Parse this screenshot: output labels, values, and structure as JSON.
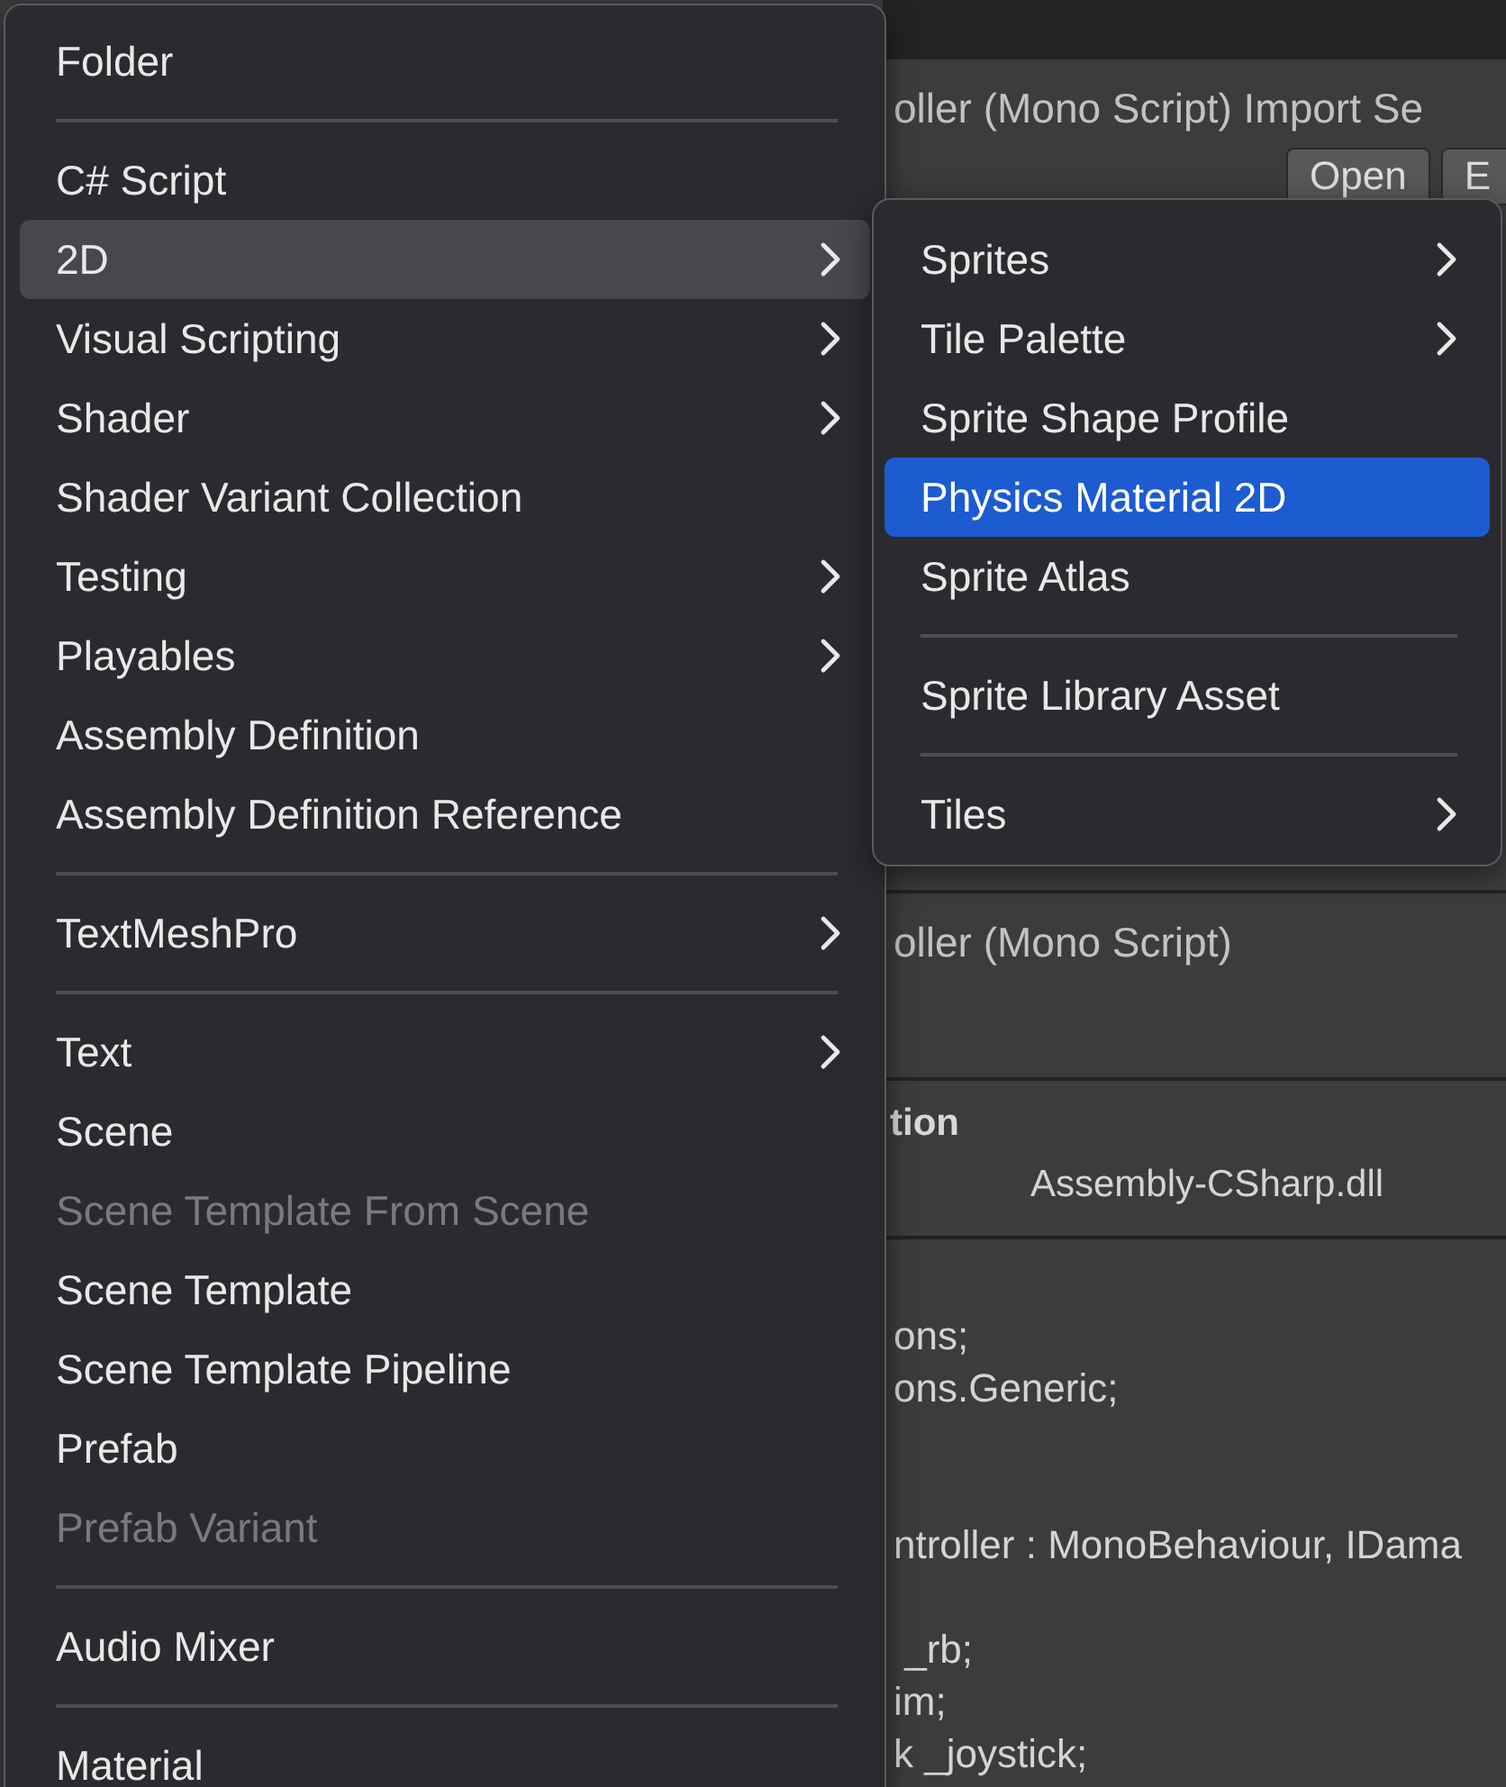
{
  "inspector": {
    "title": "oller (Mono Script) Import Se",
    "buttons": [
      "Open",
      "E"
    ],
    "subtitle": "oller (Mono Script)",
    "section_heading": "tion",
    "assembly": "Assembly-CSharp.dll",
    "code_lines": [
      {
        "kind": "blank"
      },
      {
        "kind": "line",
        "text": "ons;"
      },
      {
        "kind": "line",
        "text": "ons.Generic;"
      },
      {
        "kind": "blank"
      },
      {
        "kind": "blank"
      },
      {
        "kind": "line",
        "text": "ntroller : MonoBehaviour, IDama"
      },
      {
        "kind": "blank"
      },
      {
        "kind": "line",
        "text": " _rb;"
      },
      {
        "kind": "line",
        "text": "im;"
      },
      {
        "kind": "line",
        "text": "k _joystick;"
      }
    ]
  },
  "menu": {
    "items": [
      {
        "kind": "item",
        "label": "Folder",
        "submenu": false,
        "disabled": false,
        "selected": false
      },
      {
        "kind": "separator"
      },
      {
        "kind": "item",
        "label": "C# Script",
        "submenu": false,
        "disabled": false,
        "selected": false
      },
      {
        "kind": "item",
        "label": "2D",
        "submenu": true,
        "disabled": false,
        "selected": true
      },
      {
        "kind": "item",
        "label": "Visual Scripting",
        "submenu": true,
        "disabled": false,
        "selected": false
      },
      {
        "kind": "item",
        "label": "Shader",
        "submenu": true,
        "disabled": false,
        "selected": false
      },
      {
        "kind": "item",
        "label": "Shader Variant Collection",
        "submenu": false,
        "disabled": false,
        "selected": false
      },
      {
        "kind": "item",
        "label": "Testing",
        "submenu": true,
        "disabled": false,
        "selected": false
      },
      {
        "kind": "item",
        "label": "Playables",
        "submenu": true,
        "disabled": false,
        "selected": false
      },
      {
        "kind": "item",
        "label": "Assembly Definition",
        "submenu": false,
        "disabled": false,
        "selected": false
      },
      {
        "kind": "item",
        "label": "Assembly Definition Reference",
        "submenu": false,
        "disabled": false,
        "selected": false
      },
      {
        "kind": "separator"
      },
      {
        "kind": "item",
        "label": "TextMeshPro",
        "submenu": true,
        "disabled": false,
        "selected": false
      },
      {
        "kind": "separator"
      },
      {
        "kind": "item",
        "label": "Text",
        "submenu": true,
        "disabled": false,
        "selected": false
      },
      {
        "kind": "item",
        "label": "Scene",
        "submenu": false,
        "disabled": false,
        "selected": false
      },
      {
        "kind": "item",
        "label": "Scene Template From Scene",
        "submenu": false,
        "disabled": true,
        "selected": false
      },
      {
        "kind": "item",
        "label": "Scene Template",
        "submenu": false,
        "disabled": false,
        "selected": false
      },
      {
        "kind": "item",
        "label": "Scene Template Pipeline",
        "submenu": false,
        "disabled": false,
        "selected": false
      },
      {
        "kind": "item",
        "label": "Prefab",
        "submenu": false,
        "disabled": false,
        "selected": false
      },
      {
        "kind": "item",
        "label": "Prefab Variant",
        "submenu": false,
        "disabled": true,
        "selected": false
      },
      {
        "kind": "separator"
      },
      {
        "kind": "item",
        "label": "Audio Mixer",
        "submenu": false,
        "disabled": false,
        "selected": false
      },
      {
        "kind": "separator"
      },
      {
        "kind": "item",
        "label": "Material",
        "submenu": false,
        "disabled": false,
        "selected": false
      }
    ]
  },
  "submenu": {
    "items": [
      {
        "kind": "item",
        "label": "Sprites",
        "submenu": true,
        "disabled": false,
        "selected": false
      },
      {
        "kind": "item",
        "label": "Tile Palette",
        "submenu": true,
        "disabled": false,
        "selected": false
      },
      {
        "kind": "item",
        "label": "Sprite Shape Profile",
        "submenu": false,
        "disabled": false,
        "selected": false
      },
      {
        "kind": "item",
        "label": "Physics Material 2D",
        "submenu": false,
        "disabled": false,
        "selected": true
      },
      {
        "kind": "item",
        "label": "Sprite Atlas",
        "submenu": false,
        "disabled": false,
        "selected": false
      },
      {
        "kind": "separator"
      },
      {
        "kind": "item",
        "label": "Sprite Library Asset",
        "submenu": false,
        "disabled": false,
        "selected": false
      },
      {
        "kind": "separator"
      },
      {
        "kind": "item",
        "label": "Tiles",
        "submenu": true,
        "disabled": false,
        "selected": false
      }
    ]
  }
}
